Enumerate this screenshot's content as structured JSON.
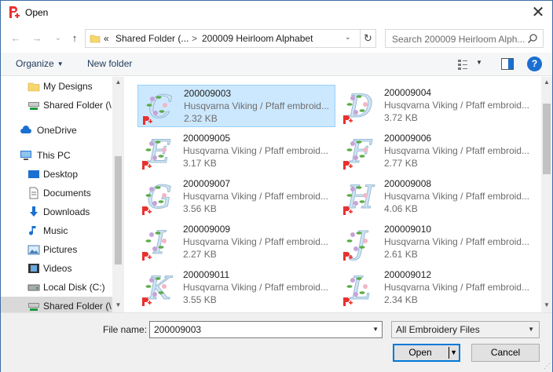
{
  "window": {
    "title": "Open",
    "close_glyph": "✕",
    "accent": "#0078d7"
  },
  "nav": {
    "back_glyph": "←",
    "forward_glyph": "→",
    "recent_glyph": "⌄",
    "up_glyph": "↑",
    "address": {
      "overflow": "«",
      "crumb1": "Shared Folder (...",
      "separator": ">",
      "crumb2": "200009 Heirloom Alphabet",
      "dropdown_glyph": "⌄"
    },
    "refresh_glyph": "↻",
    "search_placeholder": "Search 200009 Heirloom Alph..."
  },
  "toolbar": {
    "organize": "Organize",
    "new_folder": "New folder",
    "help": "?"
  },
  "sidebar": {
    "items": [
      {
        "label": "My Designs",
        "icon": "folder-icon"
      },
      {
        "label": "Shared Folder (\\",
        "icon": "network-drive-icon"
      },
      {
        "label": "OneDrive",
        "icon": "cloud-icon"
      },
      {
        "label": "This PC",
        "icon": "computer-icon"
      },
      {
        "label": "Desktop",
        "icon": "desktop-icon"
      },
      {
        "label": "Documents",
        "icon": "documents-icon"
      },
      {
        "label": "Downloads",
        "icon": "downloads-icon"
      },
      {
        "label": "Music",
        "icon": "music-icon"
      },
      {
        "label": "Pictures",
        "icon": "pictures-icon"
      },
      {
        "label": "Videos",
        "icon": "videos-icon"
      },
      {
        "label": "Local Disk (C:)",
        "icon": "local-disk-icon"
      },
      {
        "label": "Shared Folder (\\",
        "icon": "network-drive-icon"
      }
    ]
  },
  "files": [
    {
      "name": "200009003",
      "type": "Husqvarna Viking / Pfaff embroid...",
      "size": "2.32 KB",
      "letter": "C",
      "selected": true
    },
    {
      "name": "200009004",
      "type": "Husqvarna Viking / Pfaff embroid...",
      "size": "3.72 KB",
      "letter": "D",
      "selected": false
    },
    {
      "name": "200009005",
      "type": "Husqvarna Viking / Pfaff embroid...",
      "size": "3.17 KB",
      "letter": "E",
      "selected": false
    },
    {
      "name": "200009006",
      "type": "Husqvarna Viking / Pfaff embroid...",
      "size": "2.77 KB",
      "letter": "F",
      "selected": false
    },
    {
      "name": "200009007",
      "type": "Husqvarna Viking / Pfaff embroid...",
      "size": "3.56 KB",
      "letter": "G",
      "selected": false
    },
    {
      "name": "200009008",
      "type": "Husqvarna Viking / Pfaff embroid...",
      "size": "4.06 KB",
      "letter": "H",
      "selected": false
    },
    {
      "name": "200009009",
      "type": "Husqvarna Viking / Pfaff embroid...",
      "size": "2.27 KB",
      "letter": "I",
      "selected": false
    },
    {
      "name": "200009010",
      "type": "Husqvarna Viking / Pfaff embroid...",
      "size": "2.61 KB",
      "letter": "J",
      "selected": false
    },
    {
      "name": "200009011",
      "type": "Husqvarna Viking / Pfaff embroid...",
      "size": "3.55 KB",
      "letter": "K",
      "selected": false
    },
    {
      "name": "200009012",
      "type": "Husqvarna Viking / Pfaff embroid...",
      "size": "2.34 KB",
      "letter": "L",
      "selected": false
    }
  ],
  "footer": {
    "file_name_label": "File name:",
    "file_name_value": "200009003",
    "file_type_value": "All Embroidery Files",
    "open_button": "Open",
    "cancel_button": "Cancel"
  }
}
